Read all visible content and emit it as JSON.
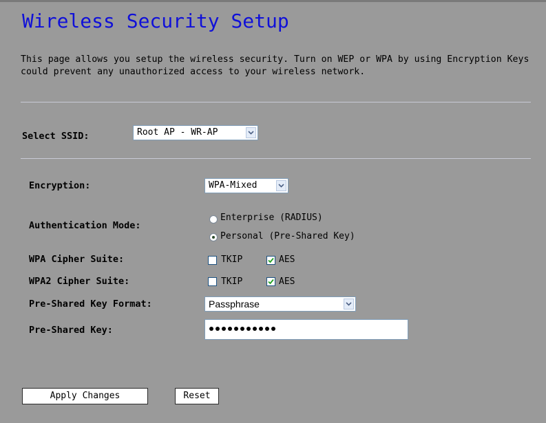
{
  "page": {
    "title": "Wireless Security Setup",
    "description": "This page allows you setup the wireless security. Turn on WEP or WPA by using Encryption Keys could prevent any unauthorized access to your wireless network."
  },
  "ssid": {
    "label": "Select SSID:",
    "value": "Root AP - WR-AP"
  },
  "form": {
    "encryption_label": "Encryption:",
    "encryption_value": "WPA-Mixed",
    "auth_mode_label": "Authentication Mode:",
    "auth_enterprise": "Enterprise (RADIUS)",
    "auth_personal": "Personal (Pre-Shared Key)",
    "auth_selected": "personal",
    "wpa_cipher_label": "WPA Cipher Suite:",
    "wpa2_cipher_label": "WPA2 Cipher Suite:",
    "tkip_label": "TKIP",
    "aes_label": "AES",
    "wpa_tkip_checked": false,
    "wpa_aes_checked": true,
    "wpa2_tkip_checked": false,
    "wpa2_aes_checked": true,
    "psk_format_label": "Pre-Shared Key Format:",
    "psk_format_value": "Passphrase",
    "psk_label": "Pre-Shared Key:",
    "psk_masked_length": 11
  },
  "buttons": {
    "apply": "Apply Changes",
    "reset": "Reset"
  },
  "icons": {
    "dropdown": "chevron-down-icon",
    "check": "checkmark-icon"
  },
  "colors": {
    "background": "#9a9a9a",
    "title": "#1010d8",
    "divider": "#c9cbd6"
  }
}
